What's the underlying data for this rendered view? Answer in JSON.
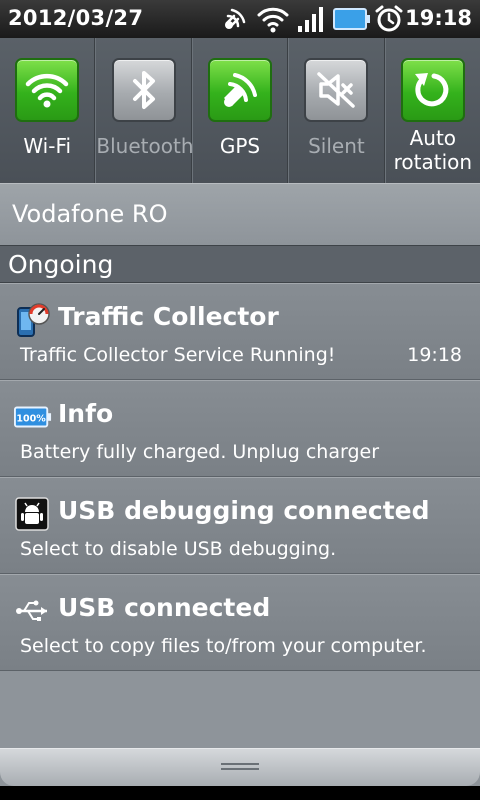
{
  "status_bar": {
    "date": "2012/03/27",
    "time": "19:18",
    "icons": [
      "gps-satellite-icon",
      "wifi-icon",
      "signal-bars-icon",
      "battery-icon",
      "alarm-clock-icon"
    ]
  },
  "quick_toggles": [
    {
      "label": "Wi-Fi",
      "state": "on",
      "icon": "wifi-icon"
    },
    {
      "label": "Bluetooth",
      "state": "off",
      "icon": "bluetooth-icon"
    },
    {
      "label": "GPS",
      "state": "on",
      "icon": "gps-satellite-icon"
    },
    {
      "label": "Silent",
      "state": "off",
      "icon": "speaker-muted-icon"
    },
    {
      "label": "Auto rotation",
      "state": "on",
      "icon": "rotate-icon"
    }
  ],
  "carrier": "Vodafone RO",
  "ongoing": {
    "title": "Ongoing",
    "notifications": [
      {
        "title": "Traffic Collector",
        "text": "Traffic Collector Service Running!",
        "time": "19:18",
        "icon": "traffic-collector-icon"
      },
      {
        "title": "Info",
        "text": "Battery fully charged. Unplug charger",
        "icon": "battery-full-icon",
        "icon_text": "100%"
      },
      {
        "title": "USB debugging connected",
        "text": "Select to disable USB debugging.",
        "icon": "android-debug-icon"
      },
      {
        "title": "USB connected",
        "text": "Select to copy files to/from your computer.",
        "icon": "usb-icon"
      }
    ]
  },
  "colors": {
    "toggle_on": "#34b21c",
    "toggle_off": "#a7abaf",
    "panel": "#8e949a"
  }
}
